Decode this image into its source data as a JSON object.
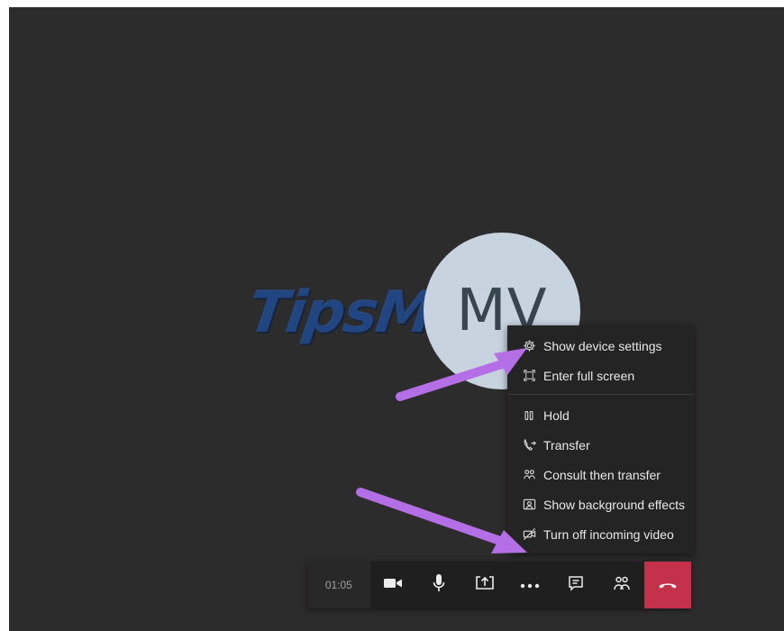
{
  "caller": {
    "initials": "MV"
  },
  "watermark": {
    "text": "TipsMake"
  },
  "more_menu": {
    "items": [
      {
        "label": "Show device settings",
        "icon": "gear-icon"
      },
      {
        "label": "Enter full screen",
        "icon": "fullscreen-icon"
      },
      {
        "label": "Hold",
        "icon": "pause-icon"
      },
      {
        "label": "Transfer",
        "icon": "transfer-icon"
      },
      {
        "label": "Consult then transfer",
        "icon": "consult-transfer-icon"
      },
      {
        "label": "Show background effects",
        "icon": "background-effects-icon"
      },
      {
        "label": "Turn off incoming video",
        "icon": "video-off-icon"
      }
    ]
  },
  "call_toolbar": {
    "timer": "01:05",
    "buttons": [
      "camera-icon",
      "microphone-icon",
      "share-screen-icon",
      "more-options-icon",
      "chat-icon",
      "participants-icon",
      "hang-up-icon"
    ]
  },
  "colors": {
    "background": "#2d2c2c",
    "menu": "#252424",
    "toolbar": "#201f1f",
    "hang_up": "#c4314b",
    "annotation_arrow": "#b56fe6"
  }
}
